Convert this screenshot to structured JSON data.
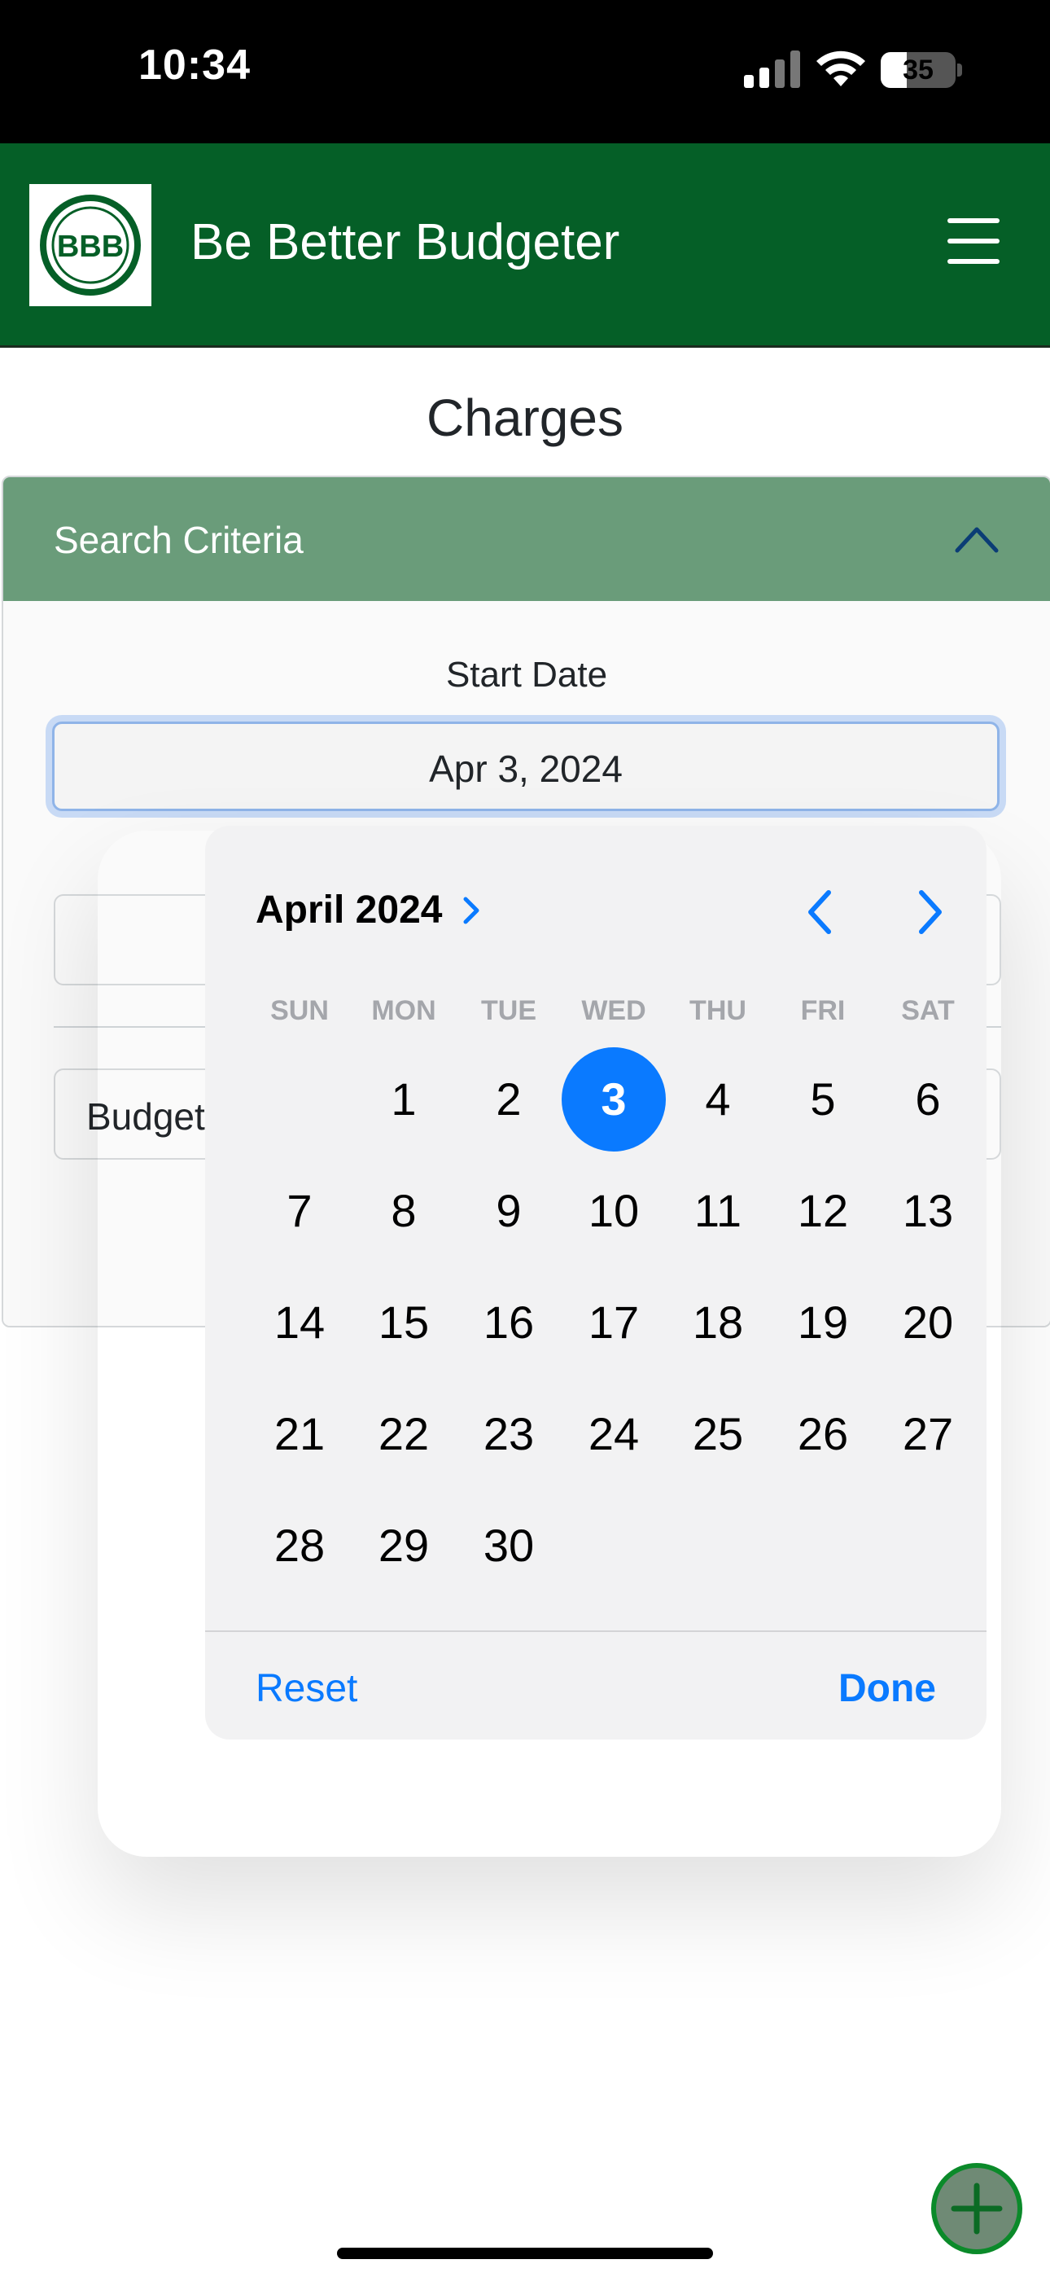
{
  "status_bar": {
    "time": "10:34",
    "battery_level": "35",
    "battery_fraction": 0.35
  },
  "navbar": {
    "logo_text": "BBB",
    "brand_title": "Be Better Budgeter",
    "brand_color": "#055f27"
  },
  "page": {
    "title": "Charges"
  },
  "search_card": {
    "header_label": "Search Criteria",
    "header_color": "#6a9c7a",
    "start_date_label": "Start Date",
    "start_date_value": "Apr 3, 2024",
    "end_date_value": "",
    "budget_select_text": "Budget"
  },
  "date_picker": {
    "month_label": "April 2024",
    "weekdays": [
      "SUN",
      "MON",
      "TUE",
      "WED",
      "THU",
      "FRI",
      "SAT"
    ],
    "first_weekday_index": 1,
    "days_in_month": 30,
    "selected_day": 3,
    "reset_label": "Reset",
    "done_label": "Done",
    "accent_color": "#0a7aff"
  },
  "icons": {
    "menu": "hamburger-icon",
    "collapse": "chevron-up-icon",
    "month_expand": "chevron-right-icon",
    "prev": "chevron-left-icon",
    "next": "chevron-right-icon",
    "add": "plus-icon"
  }
}
